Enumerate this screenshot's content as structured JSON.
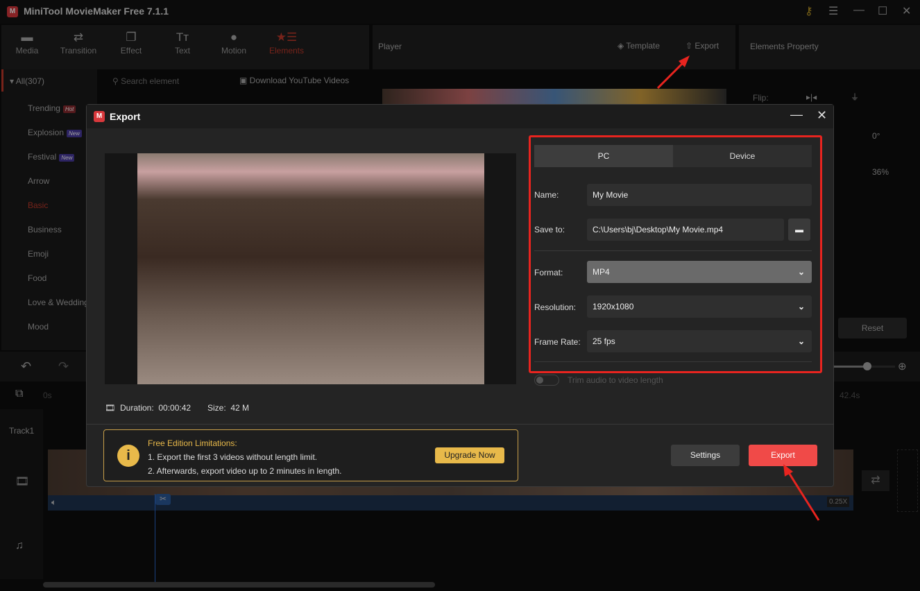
{
  "app": {
    "title": "MiniTool MovieMaker Free 7.1.1"
  },
  "toolbar": [
    {
      "label": "Media",
      "icon": "folder-icon"
    },
    {
      "label": "Transition",
      "icon": "swap-icon"
    },
    {
      "label": "Effect",
      "icon": "effect-icon"
    },
    {
      "label": "Text",
      "icon": "text-icon"
    },
    {
      "label": "Motion",
      "icon": "motion-icon"
    },
    {
      "label": "Elements",
      "icon": "elements-icon",
      "active": true
    }
  ],
  "player": {
    "title": "Player",
    "template_label": "Template",
    "export_label": "Export"
  },
  "property": {
    "title": "Elements Property",
    "flip_label": "Flip:",
    "rotation": "0°",
    "scale": "36%",
    "reset_label": "Reset"
  },
  "sidebar": {
    "all_label": "All(307)",
    "items": [
      {
        "label": "Trending",
        "badge": "Hot"
      },
      {
        "label": "Explosion",
        "badge": "New"
      },
      {
        "label": "Festival",
        "badge": "New"
      },
      {
        "label": "Arrow"
      },
      {
        "label": "Basic",
        "active": true
      },
      {
        "label": "Business"
      },
      {
        "label": "Emoji"
      },
      {
        "label": "Food"
      },
      {
        "label": "Love & Wedding"
      },
      {
        "label": "Mood"
      }
    ]
  },
  "search": {
    "placeholder": "Search element",
    "download_label": "Download YouTube Videos"
  },
  "timeline": {
    "start": "0s",
    "end": "42.4s",
    "track_label": "Track1",
    "speed": "0.25X",
    "zoom_level": 0.7
  },
  "dialog": {
    "title": "Export",
    "tabs": [
      {
        "label": "PC",
        "active": true
      },
      {
        "label": "Device"
      }
    ],
    "name_label": "Name:",
    "name_value": "My Movie",
    "save_label": "Save to:",
    "save_value": "C:\\Users\\bj\\Desktop\\My Movie.mp4",
    "format_label": "Format:",
    "format_value": "MP4",
    "resolution_label": "Resolution:",
    "resolution_value": "1920x1080",
    "framerate_label": "Frame Rate:",
    "framerate_value": "25 fps",
    "trim_label": "Trim audio to video length",
    "trim_on": false,
    "duration_label": "Duration:",
    "duration_value": "00:00:42",
    "size_label": "Size:",
    "size_value": "42 M",
    "notice_title": "Free Edition Limitations:",
    "notice_line1": "1. Export the first 3 videos without length limit.",
    "notice_line2": "2. Afterwards, export video up to 2 minutes in length.",
    "upgrade_label": "Upgrade Now",
    "settings_label": "Settings",
    "export_label": "Export"
  },
  "colors": {
    "accent": "#f04a48",
    "highlight_box": "#e8241f",
    "notice": "#e8b94a",
    "active_nav": "#c0392b"
  }
}
